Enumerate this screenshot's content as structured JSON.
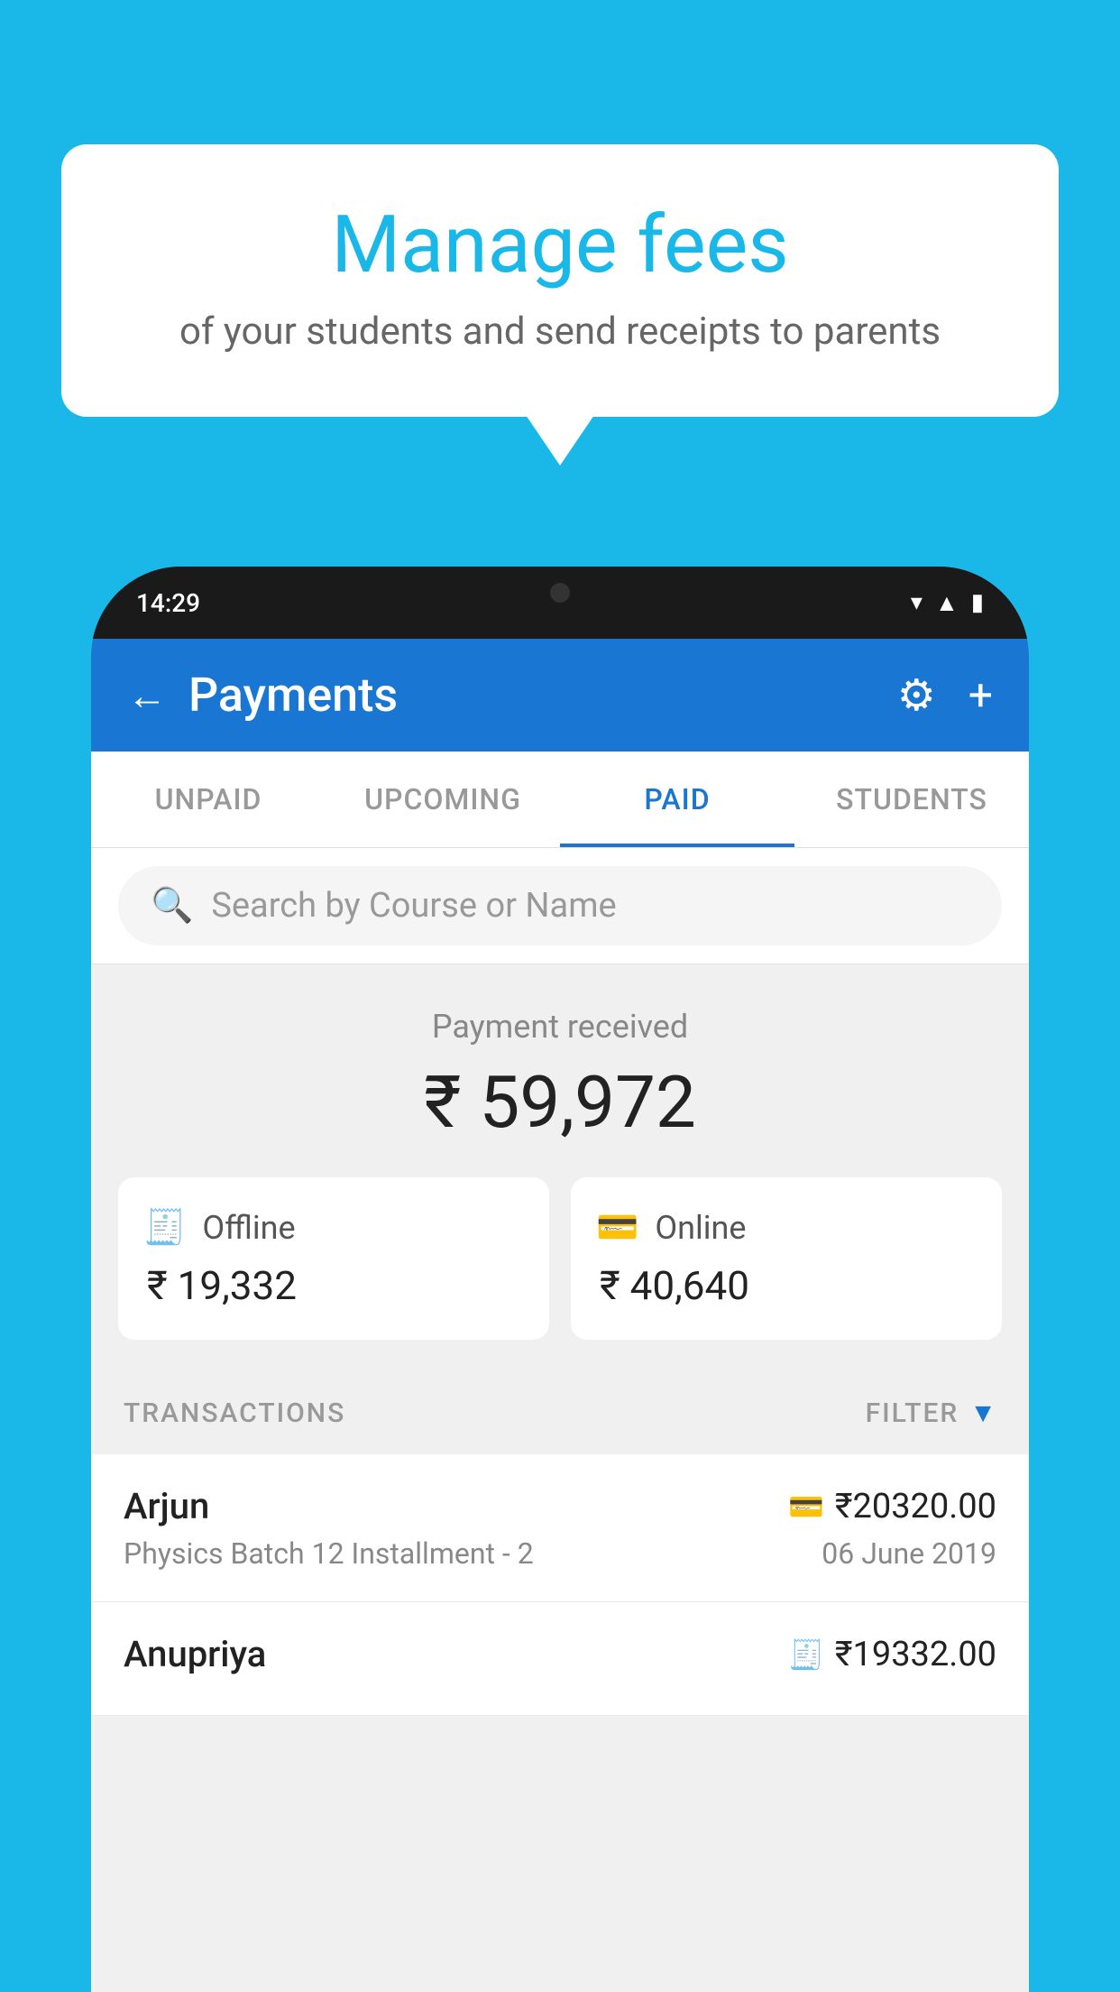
{
  "page": {
    "background_color": "#1ab8e8"
  },
  "speech_bubble": {
    "title": "Manage fees",
    "subtitle": "of your students and send receipts to parents"
  },
  "status_bar": {
    "time": "14:29",
    "icons": [
      "wifi",
      "signal",
      "battery"
    ]
  },
  "header": {
    "title": "Payments",
    "back_label": "←",
    "settings_label": "⚙",
    "add_label": "+"
  },
  "tabs": [
    {
      "label": "UNPAID",
      "active": false
    },
    {
      "label": "UPCOMING",
      "active": false
    },
    {
      "label": "PAID",
      "active": true
    },
    {
      "label": "STUDENTS",
      "active": false
    }
  ],
  "search": {
    "placeholder": "Search by Course or Name"
  },
  "payment_summary": {
    "received_label": "Payment received",
    "total_amount": "₹ 59,972",
    "offline": {
      "label": "Offline",
      "amount": "₹ 19,332"
    },
    "online": {
      "label": "Online",
      "amount": "₹ 40,640"
    }
  },
  "transactions": {
    "section_label": "TRANSACTIONS",
    "filter_label": "FILTER",
    "items": [
      {
        "name": "Arjun",
        "amount": "₹20320.00",
        "course": "Physics Batch 12 Installment - 2",
        "date": "06 June 2019",
        "type": "online"
      },
      {
        "name": "Anupriya",
        "amount": "₹19332.00",
        "course": "",
        "date": "",
        "type": "offline"
      }
    ]
  }
}
